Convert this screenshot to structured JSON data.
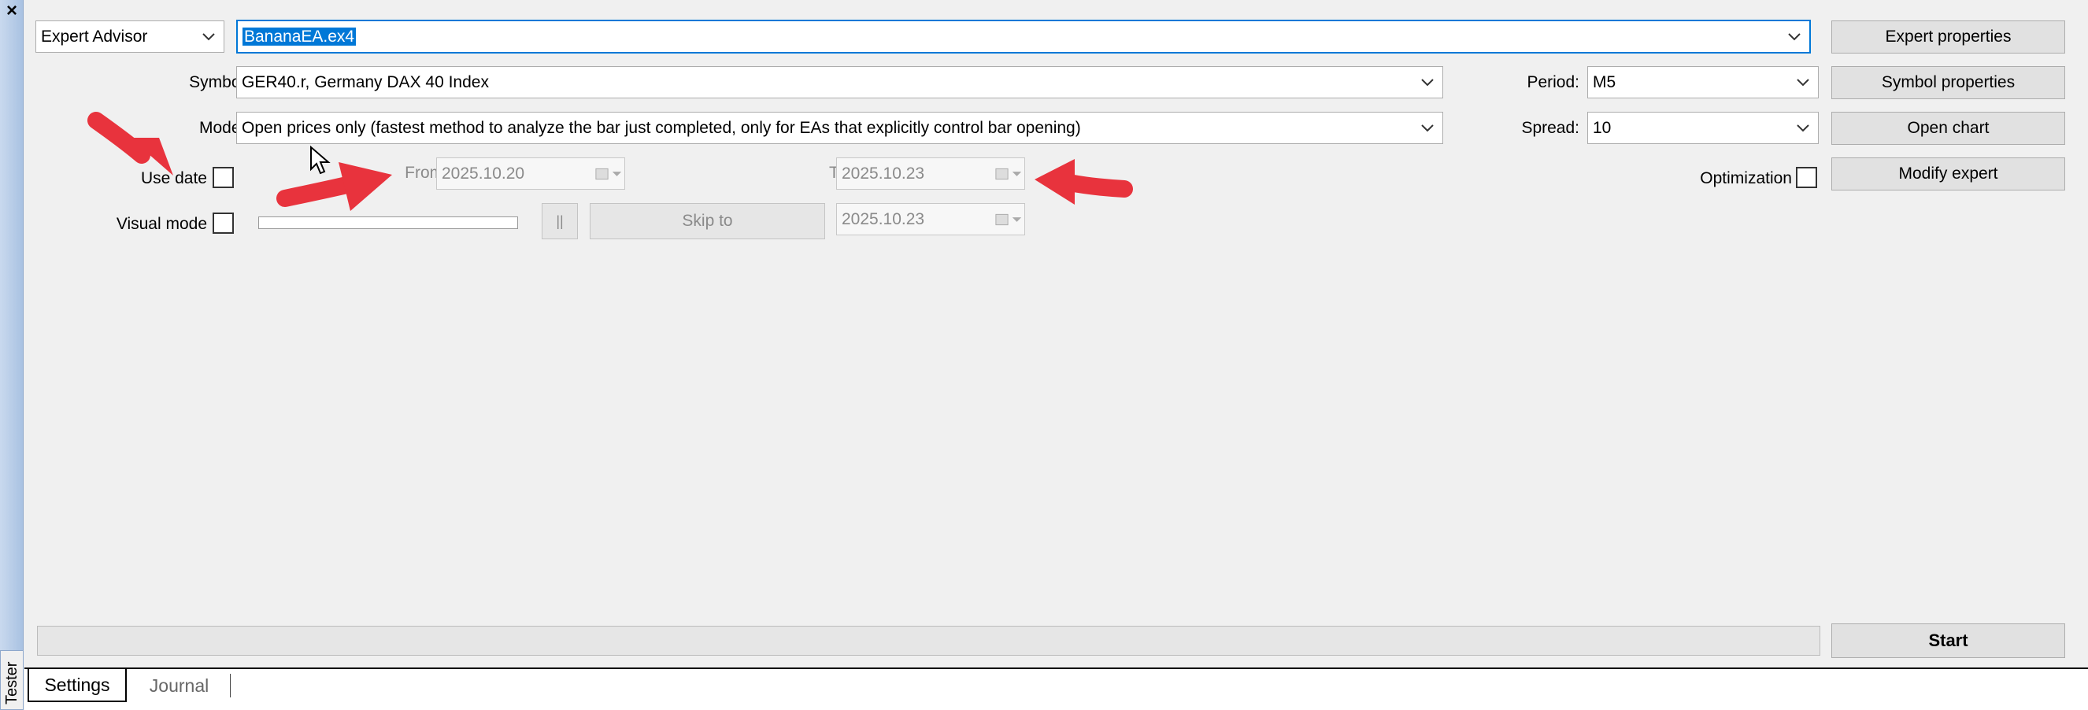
{
  "window": {
    "close_glyph": "×",
    "side_tab_label": "Tester"
  },
  "row1": {
    "type_value": "Expert Advisor",
    "expert_file": "BananaEA.ex4",
    "expert_properties": "Expert properties"
  },
  "row2": {
    "symbol_label": "Symbol:",
    "symbol_value": "GER40.r, Germany DAX 40 Index",
    "period_label": "Period:",
    "period_value": "M5",
    "symbol_properties": "Symbol properties"
  },
  "row3": {
    "model_label": "Model:",
    "model_value": "Open prices only (fastest method to analyze the bar just completed, only for EAs that explicitly control bar opening)",
    "spread_label": "Spread:",
    "spread_value": "10",
    "open_chart": "Open chart"
  },
  "row4": {
    "use_date_label": "Use date",
    "from_label": "From:",
    "from_value": "2025.10.20",
    "to_label": "To:",
    "to_value": "2025.10.23",
    "optimization_label": "Optimization",
    "modify_expert": "Modify expert"
  },
  "row5": {
    "visual_mode_label": "Visual mode",
    "pause_glyph": "||",
    "skip_to": "Skip to",
    "skip_date": "2025.10.23"
  },
  "footer": {
    "start": "Start"
  },
  "tabs": [
    {
      "label": "Settings"
    },
    {
      "label": "Journal"
    }
  ],
  "colors": {
    "accent": "#0078d7",
    "annotation_arrow": "#e8333d",
    "side_strip": "#b5cbe7"
  },
  "icons": [
    "close-icon",
    "chevron-down-icon",
    "calendar-icon",
    "pause-icon",
    "mouse-cursor-icon",
    "red-arrow-annotation"
  ]
}
